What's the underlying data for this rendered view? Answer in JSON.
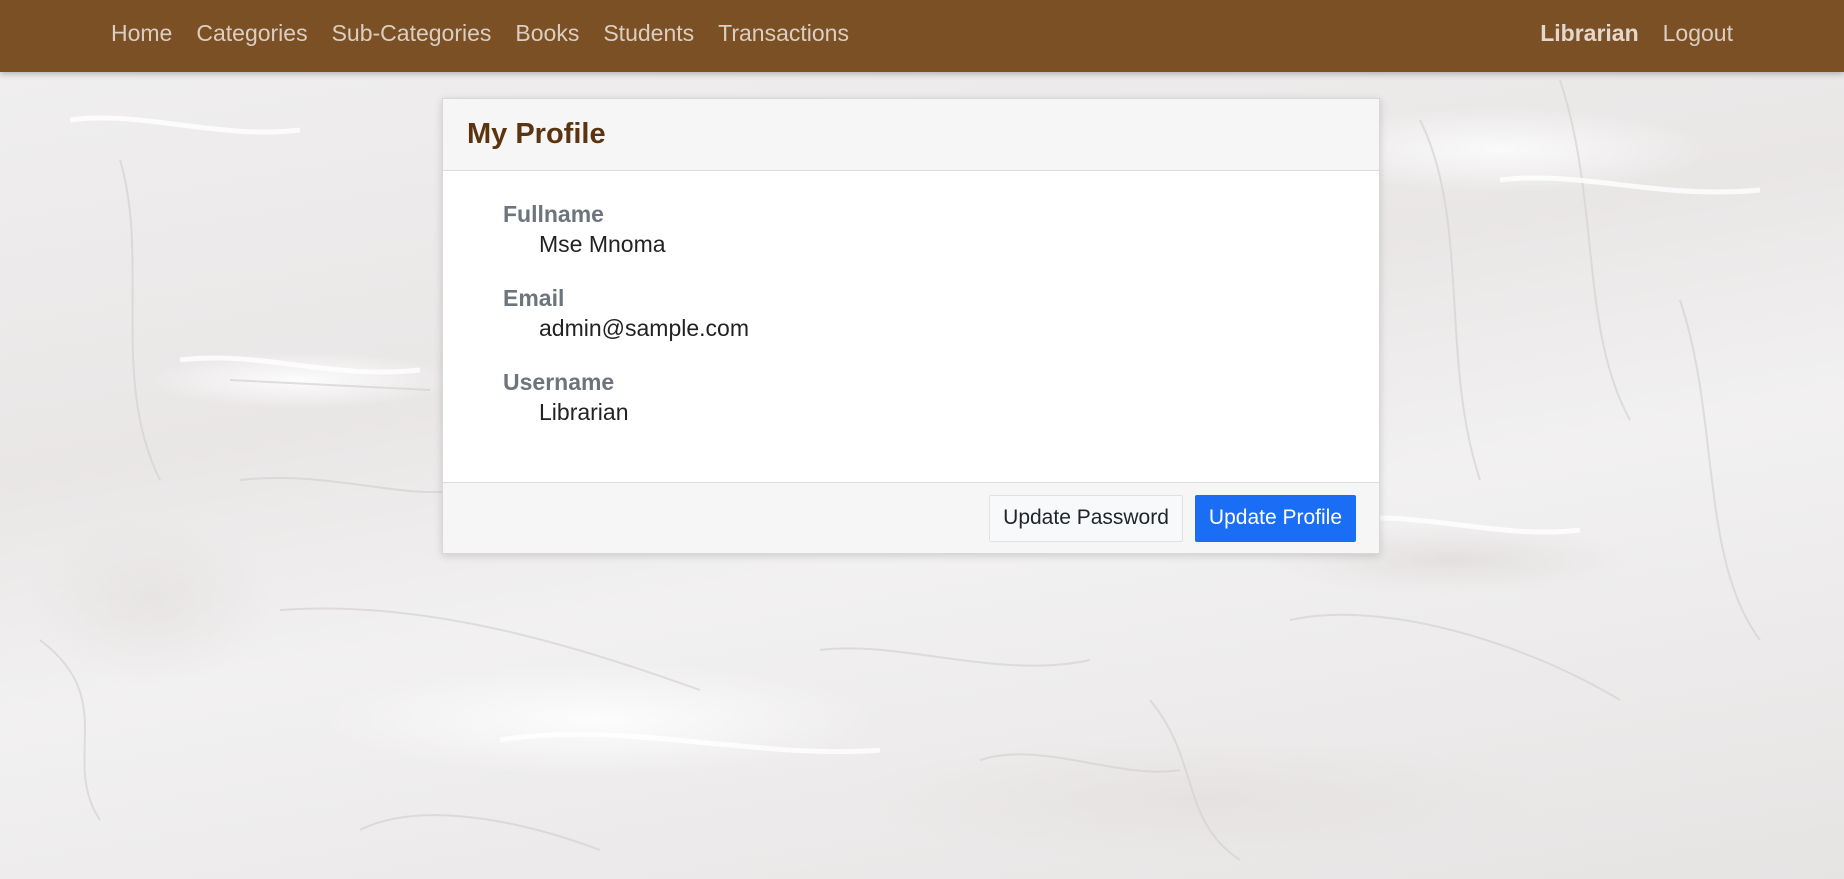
{
  "nav": {
    "links": [
      {
        "label": "Home"
      },
      {
        "label": "Categories"
      },
      {
        "label": "Sub-Categories"
      },
      {
        "label": "Books"
      },
      {
        "label": "Students"
      },
      {
        "label": "Transactions"
      }
    ],
    "user_label": "Librarian",
    "logout_label": "Logout"
  },
  "profile": {
    "title": "My Profile",
    "fields": [
      {
        "label": "Fullname",
        "value": "Mse Mnoma"
      },
      {
        "label": "Email",
        "value": "admin@sample.com"
      },
      {
        "label": "Username",
        "value": "Librarian"
      }
    ],
    "update_password_label": "Update Password",
    "update_profile_label": "Update Profile"
  },
  "colors": {
    "navbar": "#7b5024",
    "title": "#5a3510",
    "primary": "#1a6ef5"
  }
}
